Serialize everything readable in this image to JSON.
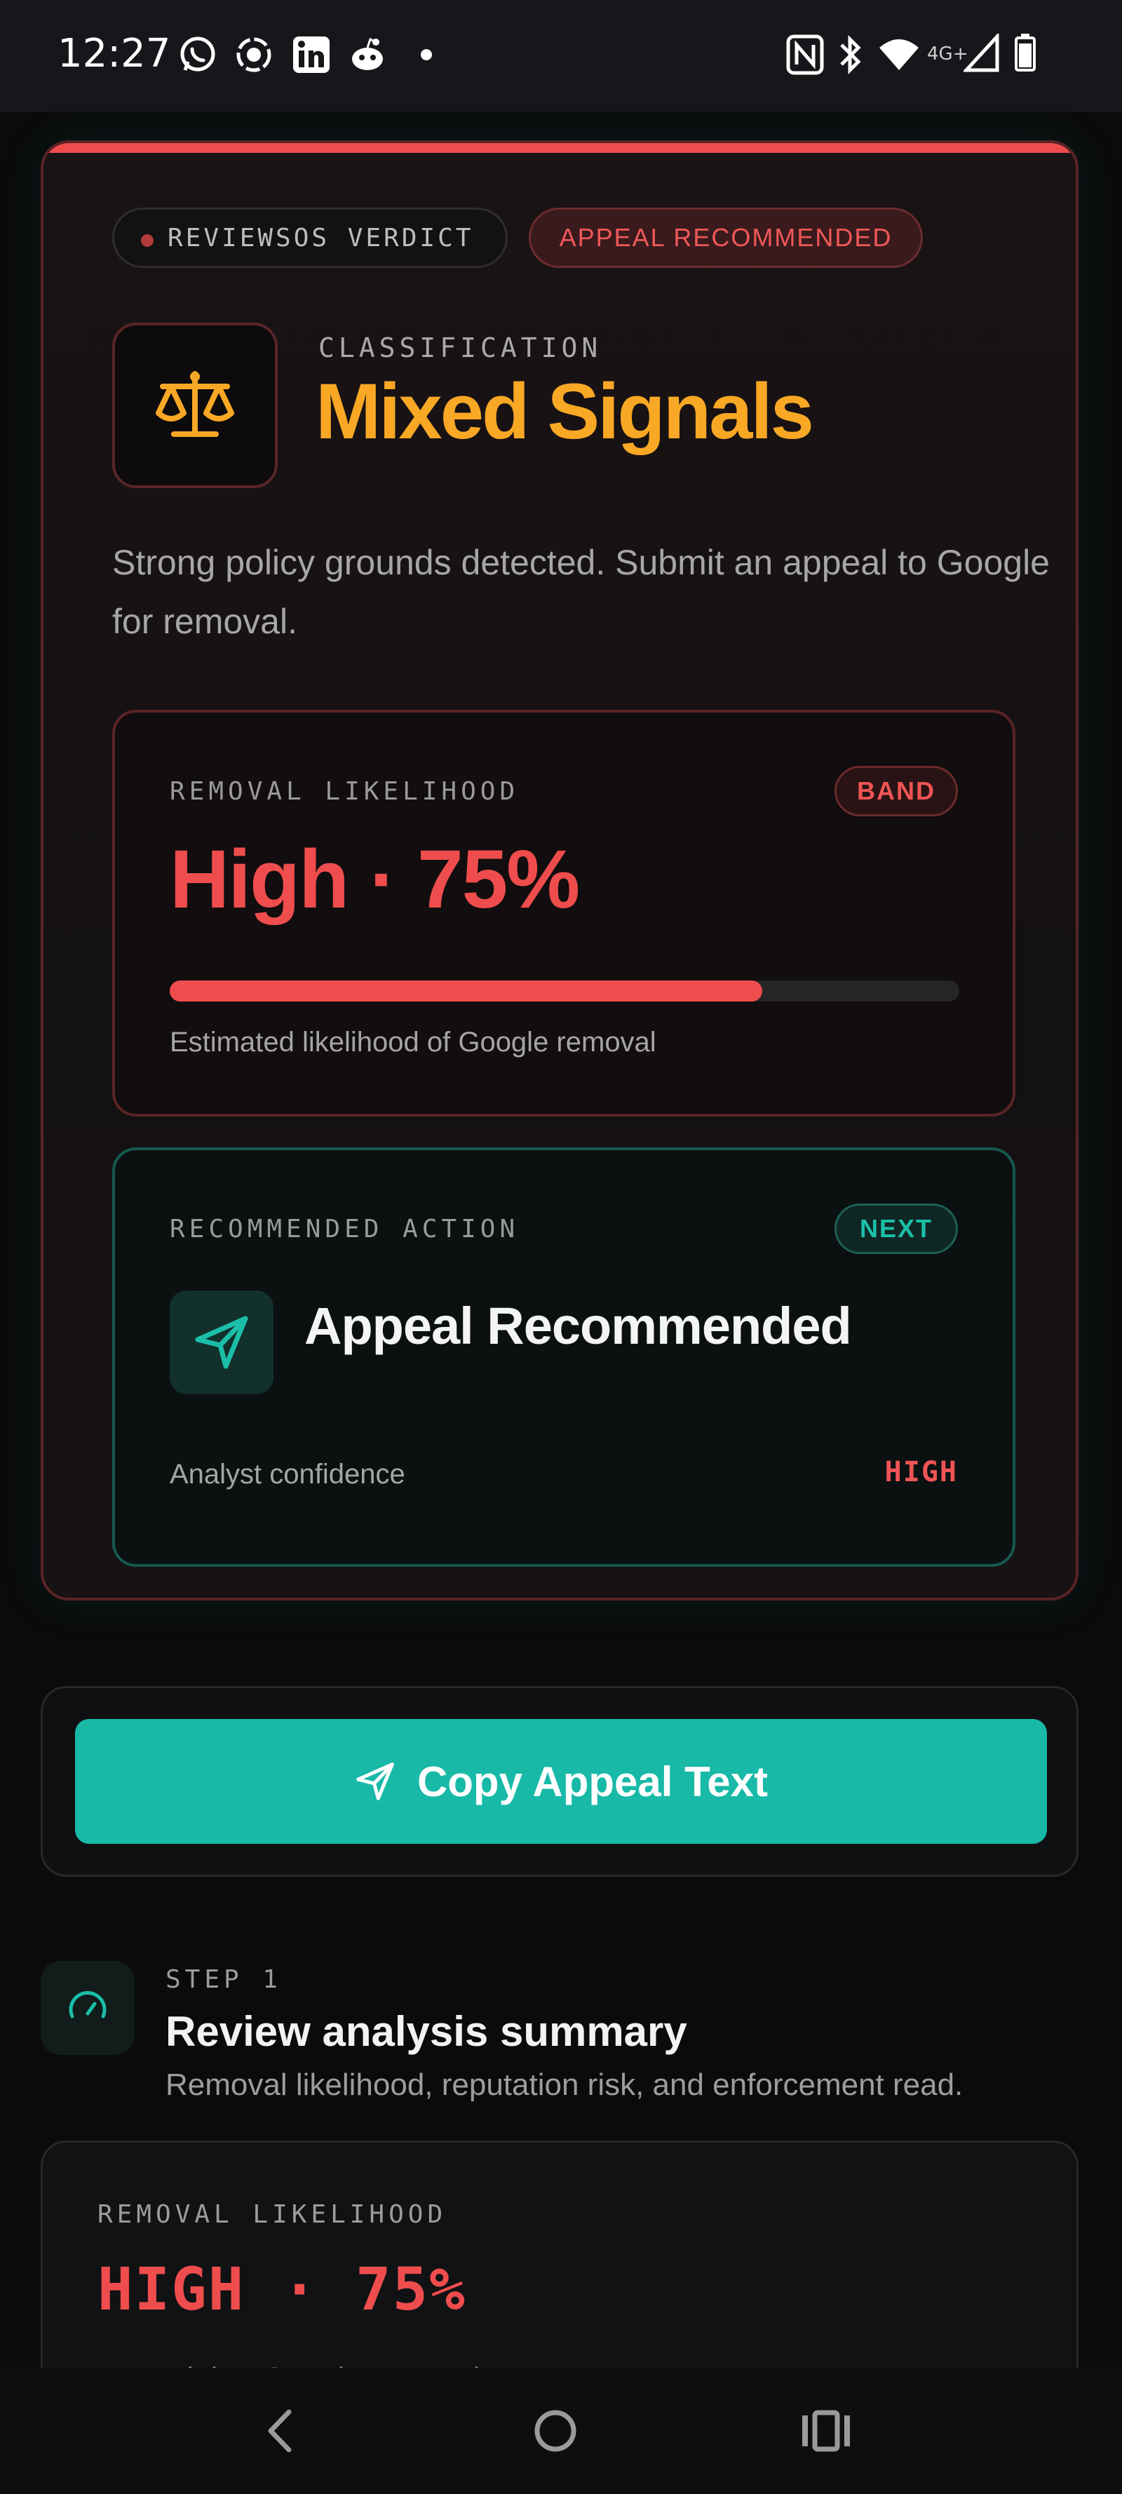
{
  "status_bar": {
    "time": "12:27",
    "left_icons": [
      "whatsapp-icon",
      "screen-record-icon",
      "linkedin-icon",
      "reddit-icon",
      "dot-icon"
    ],
    "right_icons": [
      "nfc-icon",
      "bluetooth-icon",
      "wifi-icon",
      "signal-icon",
      "battery-icon"
    ],
    "network": "4G+"
  },
  "verdict": {
    "badge_label": "REVIEWSOS VERDICT",
    "status_pill": "APPEAL RECOMMENDED",
    "classification_label": "CLASSIFICATION",
    "classification_title": "Mixed Signals",
    "description": "Strong policy grounds detected. Submit an appeal to Google for removal.",
    "accent_color": "#ef4d4d",
    "title_color": "#f9a825"
  },
  "likelihood": {
    "label": "REMOVAL LIKELIHOOD",
    "badge": "BAND",
    "value_text": "High · 75%",
    "progress": 0.75,
    "caption": "Estimated likelihood of Google removal"
  },
  "action": {
    "label": "RECOMMENDED ACTION",
    "badge": "NEXT",
    "title": "Appeal Recommended",
    "confidence_label": "Analyst confidence",
    "confidence_value": "HIGH",
    "accent_color": "#18b9a7"
  },
  "copy_button": {
    "label": "Copy Appeal Text"
  },
  "step": {
    "label": "STEP 1",
    "title": "Review analysis summary",
    "subtitle": "Removal likelihood, reputation risk, and enforcement read."
  },
  "summary": {
    "label": "REMOVAL LIKELIHOOD",
    "value_text": "HIGH · 75%",
    "partial_text": "Potential or Google removal"
  },
  "nav": {
    "items": [
      "back-icon",
      "home-icon",
      "recents-icon"
    ]
  }
}
